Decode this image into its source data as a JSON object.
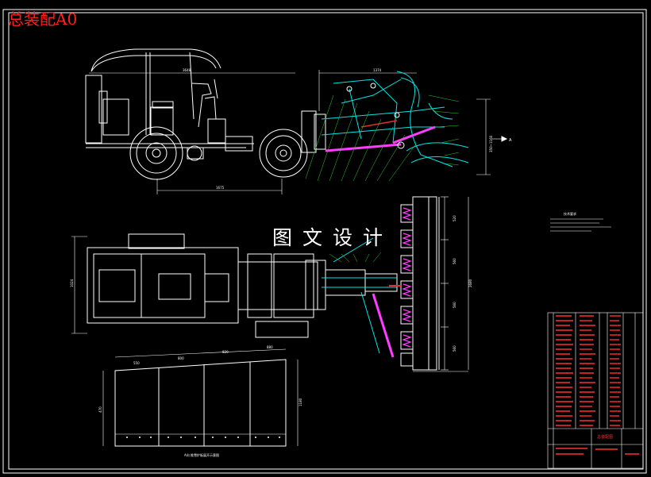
{
  "sheet": {
    "label": "总装配A0",
    "watermark": "图文设计",
    "colors": {
      "background": "#000000",
      "line": "#ffffff",
      "label_red": "#ff2020",
      "part_cyan": "#00e5e5",
      "part_magenta": "#ff3cff",
      "callout_green": "#33cc33",
      "accent_red": "#e03030"
    }
  },
  "side_view": {
    "dimensions": [
      "3648",
      "1374",
      "1675",
      "350~1160"
    ],
    "section_mark": "A"
  },
  "plan_view": {
    "dimensions": [
      "1024",
      "520",
      "560",
      "560",
      "560",
      "560",
      "2680"
    ]
  },
  "blade_section": {
    "dimensions": [
      "550",
      "800",
      "820",
      "880",
      "470",
      "1180"
    ],
    "caption": "A向 推雪铲板展开示意图"
  },
  "notes_block": {
    "title": "技术要求"
  },
  "title_block": {
    "drawing_name": "总装配图"
  }
}
